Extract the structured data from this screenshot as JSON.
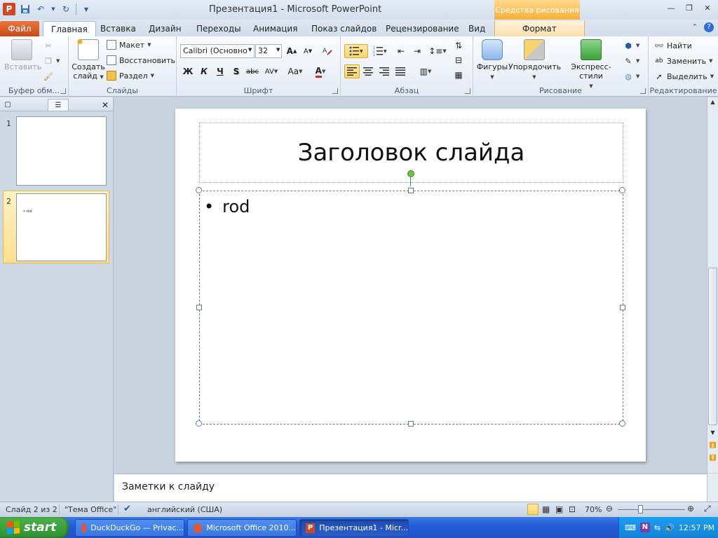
{
  "window": {
    "title": "Презентация1  -  Microsoft PowerPoint",
    "app_icon_letter": "P",
    "context_tab_title": "Средства рисования"
  },
  "tabs": {
    "file": "Файл",
    "home": "Главная",
    "insert": "Вставка",
    "design": "Дизайн",
    "transitions": "Переходы",
    "animation": "Анимация",
    "slideshow": "Показ слайдов",
    "review": "Рецензирование",
    "view": "Вид",
    "format": "Формат"
  },
  "ribbon": {
    "clipboard": {
      "label": "Буфер обм...",
      "paste": "Вставить"
    },
    "slides": {
      "label": "Слайды",
      "new_slide_line1": "Создать",
      "new_slide_line2": "слайд",
      "layout": "Макет",
      "reset": "Восстановить",
      "section": "Раздел"
    },
    "font": {
      "label": "Шрифт",
      "font_name": "Calibri (Основно",
      "font_size": "32",
      "grow": "A",
      "shrink": "A",
      "bold": "Ж",
      "italic": "К",
      "underline": "Ч",
      "shadow": "S",
      "strike": "abc",
      "spacing": "AV",
      "case": "Aa",
      "color": "A",
      "font_color_hex": "#d8232a"
    },
    "paragraph": {
      "label": "Абзац"
    },
    "drawing": {
      "label": "Рисование",
      "shapes": "Фигуры",
      "arrange": "Упорядочить",
      "quick_styles": "Экспресс-стили"
    },
    "editing": {
      "label": "Редактирование",
      "find": "Найти",
      "replace": "Заменить",
      "select": "Выделить"
    }
  },
  "slide_panel": {
    "thumbnails": [
      {
        "number": "1",
        "preview_text": ""
      },
      {
        "number": "2",
        "preview_text": "• rod"
      }
    ],
    "selected_index": 1
  },
  "slide": {
    "title": "Заголовок слайда",
    "bullets": [
      "rod"
    ]
  },
  "notes": {
    "text": "Заметки к слайду"
  },
  "status": {
    "slide_info": "Слайд 2 из 2",
    "theme": "\"Тема Office\"",
    "language": "английский (США)",
    "zoom": "70%"
  },
  "taskbar": {
    "start": "start",
    "buttons": [
      {
        "label": "DuckDuckGo — Privac...",
        "active": false
      },
      {
        "label": "Microsoft Office 2010...",
        "active": false
      },
      {
        "label": "Презентация1 - Micr...",
        "active": true
      }
    ],
    "clock": "12:57 PM"
  },
  "colors": {
    "accent_orange": "#c74a1a",
    "context_tab": "#f8b13a",
    "selection_yellow": "#ffd466",
    "taskbar_blue": "#245edb",
    "start_green": "#2f8f2f"
  }
}
